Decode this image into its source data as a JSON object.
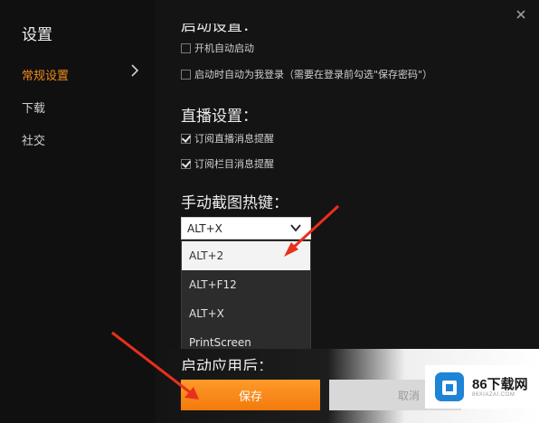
{
  "sidebar": {
    "title": "设置",
    "items": [
      {
        "label": "常规设置",
        "active": true
      },
      {
        "label": "下载",
        "active": false
      },
      {
        "label": "社交",
        "active": false
      }
    ]
  },
  "sections": {
    "startup": {
      "title": "启动设置：",
      "options": [
        {
          "label": "开机自动启动",
          "checked": false
        },
        {
          "label": "启动时自动为我登录（需要在登录前勾选\"保存密码\"）",
          "checked": false
        }
      ]
    },
    "live": {
      "title": "直播设置：",
      "options": [
        {
          "label": "订阅直播消息提醒",
          "checked": true
        },
        {
          "label": "订阅栏目消息提醒",
          "checked": true
        }
      ]
    },
    "hotkey": {
      "title": "手动截图热键：",
      "selected": "ALT+X",
      "options": [
        "ALT+2",
        "ALT+F12",
        "ALT+X",
        "PrintScreen"
      ],
      "highlighted": "ALT+2"
    },
    "after_launch": {
      "title": "启动应用后："
    }
  },
  "buttons": {
    "save": "保存",
    "cancel": "取消"
  },
  "watermark": {
    "main": "86下载网",
    "sub": "86XIAZAI.COM"
  },
  "colors": {
    "accent": "#f08a1c",
    "arrow": "#e8301c",
    "background": "#141414"
  },
  "icons": [
    "close-icon",
    "chevron-right-icon",
    "chevron-down-icon",
    "checkbox-icon",
    "watermark-logo-icon"
  ]
}
